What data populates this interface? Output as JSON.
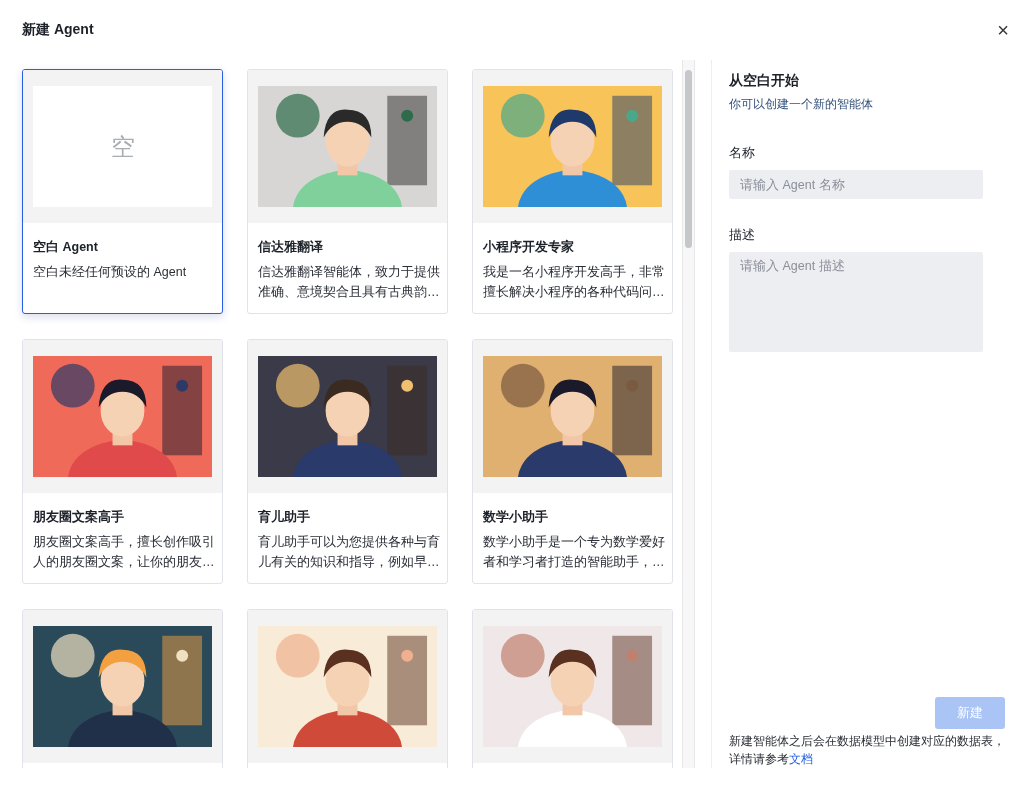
{
  "dialog": {
    "title": "新建 Agent",
    "close": "×"
  },
  "cards": [
    {
      "kind": "blank",
      "selected": true,
      "blank_char": "空",
      "title": "空白 Agent",
      "description": "空白未经任何预设的 Agent"
    },
    {
      "kind": "picture",
      "selected": false,
      "title": "信达雅翻译",
      "description": "信达雅翻译智能体，致力于提供准确、意境契合且具有古典韵…"
    },
    {
      "kind": "picture",
      "selected": false,
      "title": "小程序开发专家",
      "description": "我是一名小程序开发高手，非常擅长解决小程序的各种代码问…"
    },
    {
      "kind": "picture",
      "selected": false,
      "title": "朋友圈文案高手",
      "description": "朋友圈文案高手，擅长创作吸引人的朋友圈文案，让你的朋友…"
    },
    {
      "kind": "picture",
      "selected": false,
      "title": "育儿助手",
      "description": "育儿助手可以为您提供各种与育儿有关的知识和指导，例如早…"
    },
    {
      "kind": "picture",
      "selected": false,
      "title": "数学小助手",
      "description": "数学小助手是一个专为数学爱好者和学习者打造的智能助手，…"
    },
    {
      "kind": "picture",
      "selected": false
    },
    {
      "kind": "picture",
      "selected": false
    },
    {
      "kind": "picture",
      "selected": false
    }
  ],
  "form": {
    "heading": "从空白开始",
    "subheading": "你可以创建一个新的智能体",
    "name_label": "名称",
    "name_placeholder": "请输入 Agent 名称",
    "description_label": "描述",
    "description_placeholder": "请输入 Agent 描述",
    "create_button": {
      "label": "新建",
      "disabled": true
    },
    "note": "新建智能体之后会在数据模型中创建对应的数据表，详情请参考",
    "note_link": "文档"
  }
}
